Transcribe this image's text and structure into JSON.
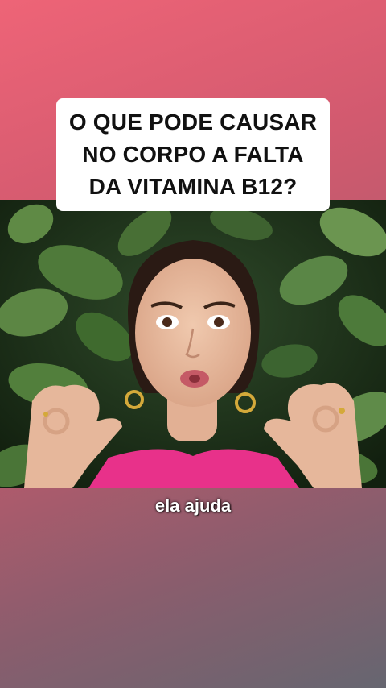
{
  "caption": {
    "lines": [
      "O QUE PODE CAUSAR",
      "NO CORPO A FALTA",
      "DA VITAMINA B12?"
    ]
  },
  "subtitle": {
    "text": "ela ajuda"
  },
  "colors": {
    "gradient_top": "#ee6477",
    "gradient_bottom": "#666670",
    "caption_bg": "#ffffff",
    "caption_text": "#111111",
    "subtitle_text": "#ffffff",
    "top_accent": "#e8446e"
  }
}
